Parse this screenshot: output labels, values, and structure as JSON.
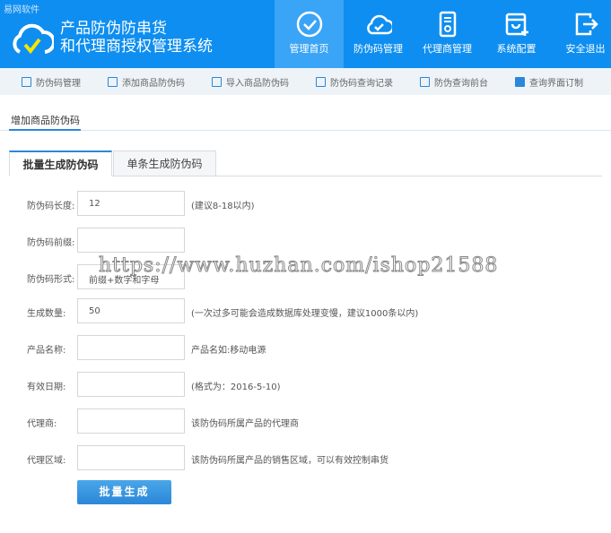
{
  "header": {
    "brand": "易网软件",
    "title_line1": "产品防伪防串货",
    "title_line2": "和代理商授权管理系统"
  },
  "nav": [
    {
      "label": "管理首页",
      "icon": "check-circle-icon"
    },
    {
      "label": "防伪码管理",
      "icon": "cloud-check-icon"
    },
    {
      "label": "代理商管理",
      "icon": "certificate-icon"
    },
    {
      "label": "系统配置",
      "icon": "box-plus-icon"
    },
    {
      "label": "安全退出",
      "icon": "logout-icon"
    }
  ],
  "subnav": [
    {
      "label": "防伪码管理"
    },
    {
      "label": "添加商品防伪码"
    },
    {
      "label": "导入商品防伪码"
    },
    {
      "label": "防伪码查询记录"
    },
    {
      "label": "防伪查询前台"
    },
    {
      "label": "查询界面订制"
    }
  ],
  "section_title": "增加商品防伪码",
  "tabs": [
    {
      "label": "批量生成防伪码"
    },
    {
      "label": "单条生成防伪码"
    }
  ],
  "form": [
    {
      "label": "防伪码长度:",
      "value": "12",
      "hint": "(建议8-18以内)"
    },
    {
      "label": "防伪码前缀:",
      "value": "",
      "hint": ""
    },
    {
      "label": "防伪码形式:",
      "value": "前缀+数字和字母",
      "hint": ""
    },
    {
      "label": "生成数量:",
      "value": "50",
      "hint": "(一次过多可能会造成数据库处理变慢，建议1000条以内)"
    },
    {
      "label": "产品名称:",
      "value": "",
      "hint": "产品名如:移动电源"
    },
    {
      "label": "有效日期:",
      "value": "",
      "hint": "(格式为：2016-5-10)"
    },
    {
      "label": "代理商:",
      "value": "",
      "hint": "该防伪码所属产品的代理商"
    },
    {
      "label": "代理区域:",
      "value": "",
      "hint": "该防伪码所属产品的销售区域，可以有效控制串货"
    }
  ],
  "submit_label": "批量生成",
  "watermark": "https://www.huzhan.com/ishop21588"
}
